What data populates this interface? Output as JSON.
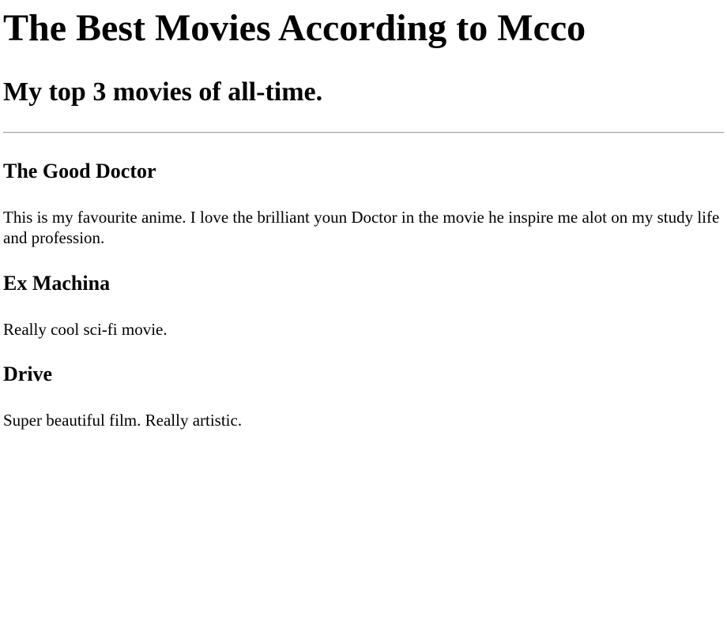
{
  "page": {
    "title": "The Best Movies According to Mcco",
    "subtitle": "My top 3 movies of all-time."
  },
  "movies": [
    {
      "title": "The Good Doctor",
      "description": "This is my favourite anime. I love the brilliant youn Doctor in the movie he inspire me alot on my study life and profession."
    },
    {
      "title": "Ex Machina",
      "description": "Really cool sci-fi movie."
    },
    {
      "title": "Drive",
      "description": "Super beautiful film. Really artistic."
    }
  ]
}
